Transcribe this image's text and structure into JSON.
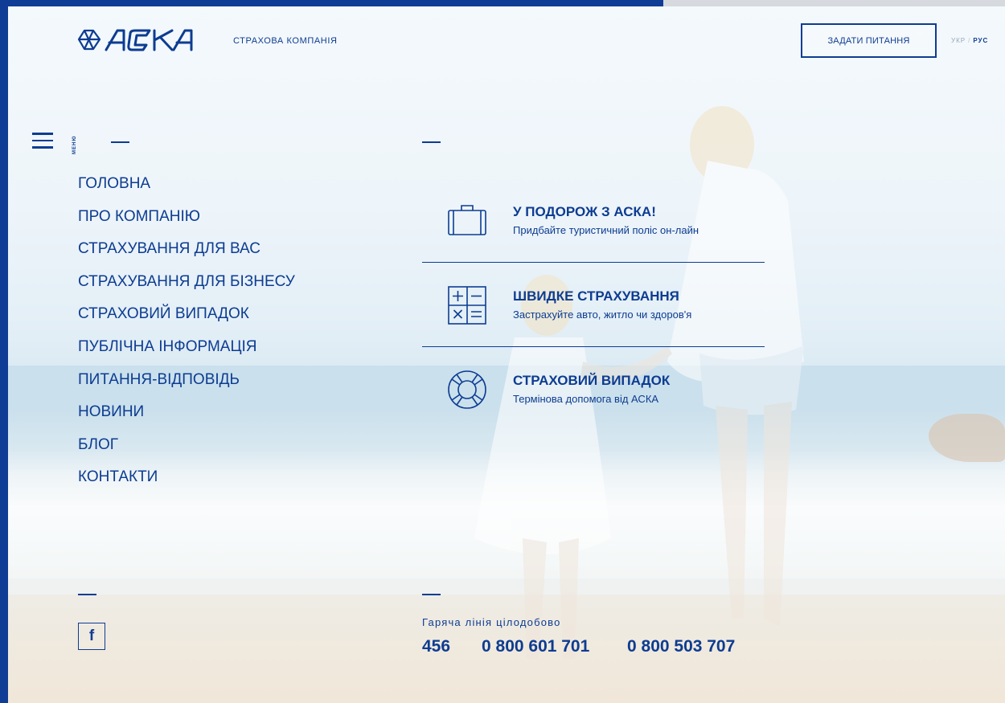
{
  "brand": {
    "logo_text": "АСКА",
    "tagline": "СТРАХОВА КОМПАНІЯ"
  },
  "header": {
    "ask_button": "ЗАДАТИ ПИТАННЯ",
    "languages": [
      {
        "label": "УКР",
        "active": false
      },
      {
        "label": "РУС",
        "active": true
      }
    ],
    "lang_separator": "/"
  },
  "menu": {
    "caption": "МЕНЮ",
    "items": [
      "ГОЛОВНА",
      "ПРО КОМПАНІЮ",
      "СТРАХУВАННЯ ДЛЯ ВАС",
      "СТРАХУВАННЯ ДЛЯ БІЗНЕСУ",
      "СТРАХОВИЙ ВИПАДОК",
      "ПУБЛІЧНА ІНФОРМАЦІЯ",
      "ПИТАННЯ-ВІДПОВІДЬ",
      "НОВИНИ",
      "БЛОГ",
      "КОНТАКТИ"
    ]
  },
  "features": [
    {
      "icon": "suitcase-icon",
      "title": "У ПОДОРОЖ З АСКА!",
      "subtitle": "Придбайте туристичний поліс он-лайн"
    },
    {
      "icon": "calculator-icon",
      "title": "ШВИДКЕ СТРАХУВАННЯ",
      "subtitle": "Застрахуйте авто, житло чи здоров'я"
    },
    {
      "icon": "lifebuoy-icon",
      "title": "СТРАХОВИЙ ВИПАДОК",
      "subtitle": "Термінова допомога від АСКА"
    }
  ],
  "social": {
    "facebook_glyph": "f"
  },
  "hotline": {
    "label": "Гаряча лінія цілодобово",
    "phones": [
      "456",
      "0 800 601 701",
      "0 800 503 707"
    ]
  },
  "colors": {
    "brand": "#0d3c91",
    "frame": "#0f3d95",
    "muted": "#9aa6b8"
  }
}
